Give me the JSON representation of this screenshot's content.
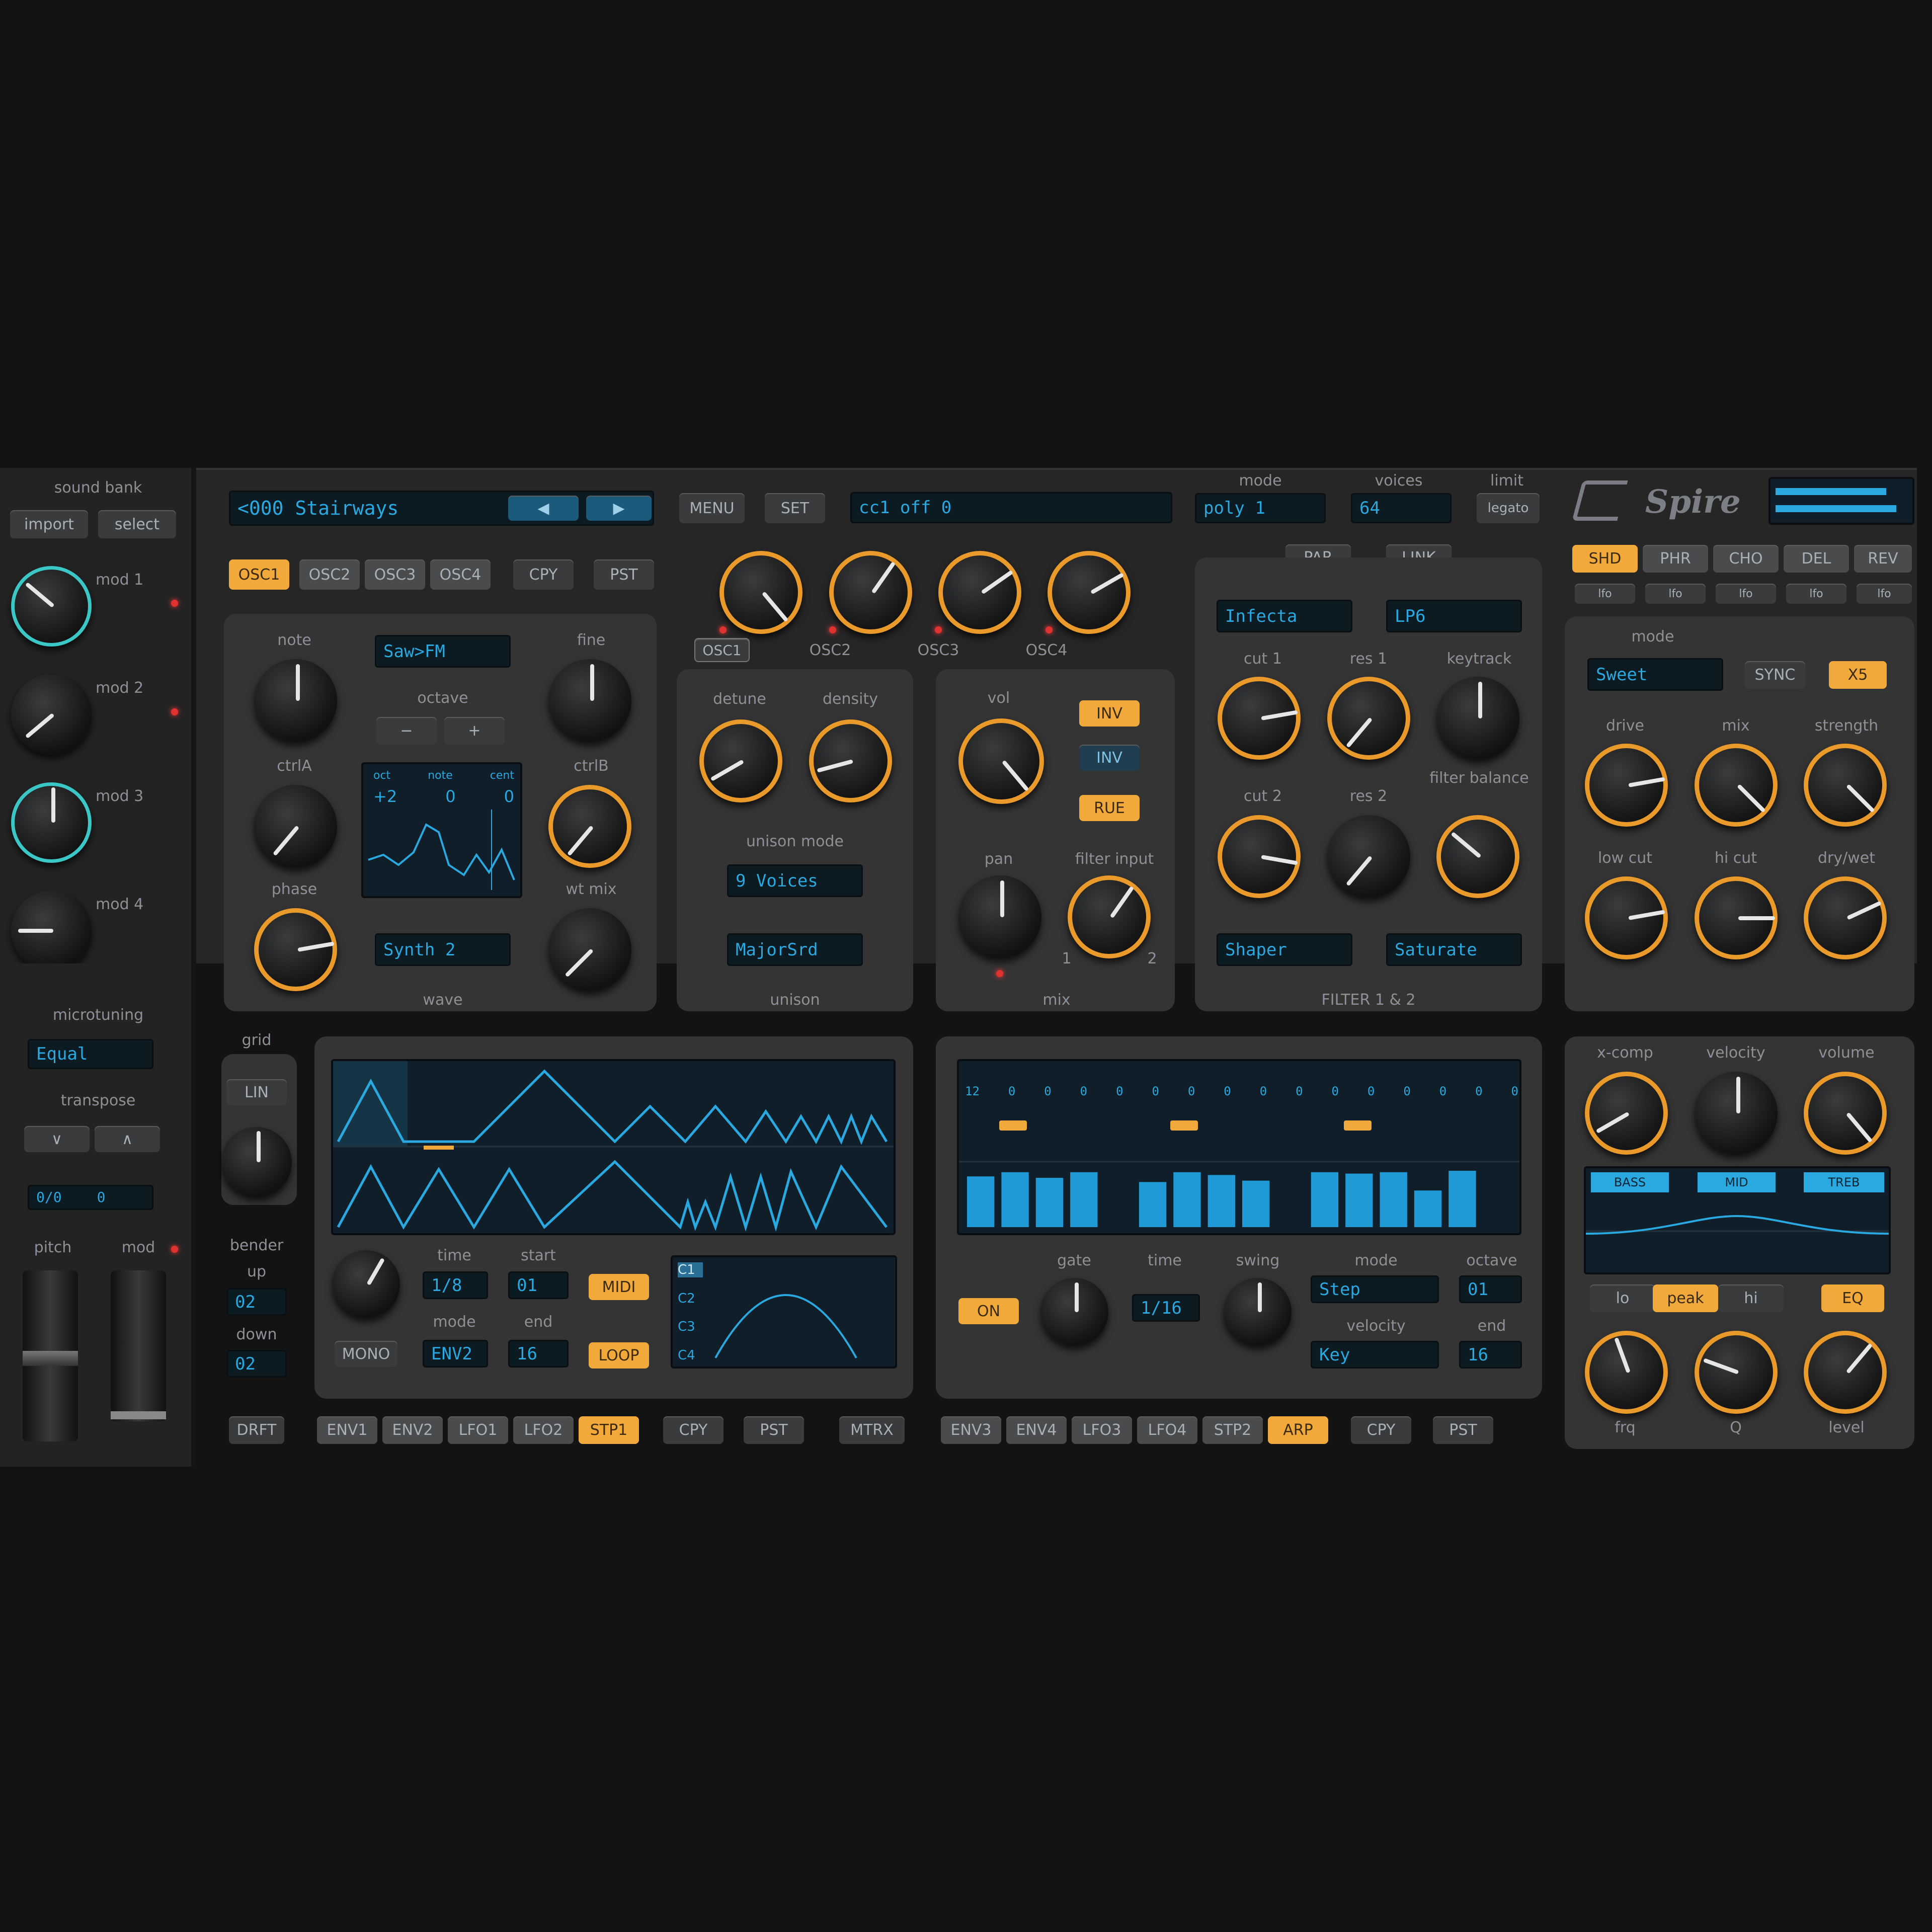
{
  "leftcol": {
    "sound_bank": "sound bank",
    "import": "import",
    "select": "select",
    "mods": [
      "mod 1",
      "mod 2",
      "mod 3",
      "mod 4"
    ],
    "microtuning": "microtuning",
    "microtuning_value": "Equal",
    "transpose": "transpose",
    "transpose_values": [
      "0/0",
      "0"
    ],
    "pitch": "pitch",
    "mod": "mod"
  },
  "header": {
    "preset_name": "<000 Stairways",
    "menu": "MENU",
    "set": "SET",
    "midi_learn": "cc1 off   0",
    "mode_label": "mode",
    "mode_value": "poly 1",
    "voices_label": "voices",
    "voices_value": "64",
    "limit_label": "limit",
    "limit_value": "legato",
    "logo": "Spire"
  },
  "osc": {
    "tabs": [
      "OSC1",
      "OSC2",
      "OSC3",
      "OSC4"
    ],
    "cpy": "CPY",
    "pst": "PST",
    "knob_labels": [
      "note",
      "ctrlA",
      "phase",
      "fine",
      "ctrlB",
      "wt mix"
    ],
    "wave_lcd": "Saw>FM",
    "octave": "octave",
    "octave_btns": [
      "−",
      "+"
    ],
    "screen_vals": [
      "+2",
      "0",
      "0"
    ],
    "screen_heads": [
      "oct",
      "note",
      "cent"
    ],
    "mode_lcd": "Synth 2",
    "wave_label": "wave",
    "unison_labels": [
      "detune",
      "density"
    ],
    "unison_mode": "unison mode",
    "unison_lcd1": "9 Voices",
    "unison_lcd2": "MajorSrd",
    "unison": "unison",
    "osc_knob_labels": [
      "OSC1",
      "OSC2",
      "OSC3",
      "OSC4"
    ]
  },
  "mix": {
    "vol": "vol",
    "btns": [
      "INV",
      "INV",
      "RUE"
    ],
    "pan": "pan",
    "filter_input": "filter input",
    "mix": "mix",
    "ticks": [
      "1",
      "2"
    ]
  },
  "filter": {
    "top_btns": [
      "PAR",
      "LINK"
    ],
    "lcd1": "Infecta",
    "lcd2": "LP6",
    "knob_labels": [
      "cut 1",
      "res 1",
      "keytrack",
      "cut 2",
      "res 2",
      "filter balance"
    ],
    "lcd3": "Shaper",
    "lcd4": "Saturate",
    "title": "FILTER 1 & 2"
  },
  "fx": {
    "tabs": [
      "SHD",
      "PHR",
      "CHO",
      "DEL",
      "REV"
    ],
    "subtabs": [
      "lfo",
      "lfo",
      "lfo",
      "lfo",
      "lfo"
    ],
    "mode": "mode",
    "mode_lcd": "Sweet",
    "btns": [
      "SYNC",
      "X5"
    ],
    "knob_labels": [
      "drive",
      "mix",
      "strength",
      "low cut",
      "hi cut",
      "dry/wet"
    ]
  },
  "env": {
    "grid": "grid",
    "lin": "LIN",
    "bender": "bender",
    "up": "up",
    "up_val": "02",
    "down": "down",
    "down_val": "02",
    "mono": "MONO",
    "time": "time",
    "start": "start",
    "mode": "mode",
    "end": "end",
    "time_val": "1/8",
    "start_val": "01",
    "mode_val": "ENV2",
    "end_val": "16",
    "btns": [
      "MIDI",
      "LOOP"
    ],
    "screen_cols": [
      "C1",
      "C2",
      "C3",
      "C4"
    ],
    "bottom_tabs": [
      "DRFT",
      "ENV1",
      "ENV2",
      "LFO1",
      "LFO2",
      "STP1"
    ],
    "cpy": "CPY",
    "pst": "PST",
    "mtrx": "MTRX"
  },
  "arp": {
    "step_vals": [
      "12",
      "0",
      "0",
      "0",
      "0",
      "0",
      "0",
      "0",
      "0",
      "0",
      "0",
      "0",
      "0",
      "0",
      "0",
      "0"
    ],
    "bar_values": [
      0.72,
      0.78,
      0.7,
      0.78,
      0,
      0.64,
      0.78,
      0.74,
      0.66,
      0,
      0.78,
      0.76,
      0.78,
      0.52,
      0.8,
      0
    ],
    "on": "ON",
    "gate": "gate",
    "time": "time",
    "time_val": "1/16",
    "swing": "swing",
    "mode": "mode",
    "mode_val": "Step",
    "octave": "octave",
    "octave_val": "01",
    "velocity": "velocity",
    "velocity_val": "Key",
    "end": "end",
    "end_val": "16",
    "bottom_tabs": [
      "ENV3",
      "ENV4",
      "LFO3",
      "LFO4",
      "STP2",
      "ARP"
    ],
    "cpy": "CPY",
    "pst": "PST"
  },
  "eq": {
    "knob_labels": [
      "x-comp",
      "velocity",
      "volume"
    ],
    "tags": [
      "BASS",
      "MID",
      "TREB"
    ],
    "shape_btns": [
      "lo",
      "peak",
      "hi",
      "EQ"
    ],
    "bottom_labels": [
      "frq",
      "Q",
      "level"
    ]
  }
}
